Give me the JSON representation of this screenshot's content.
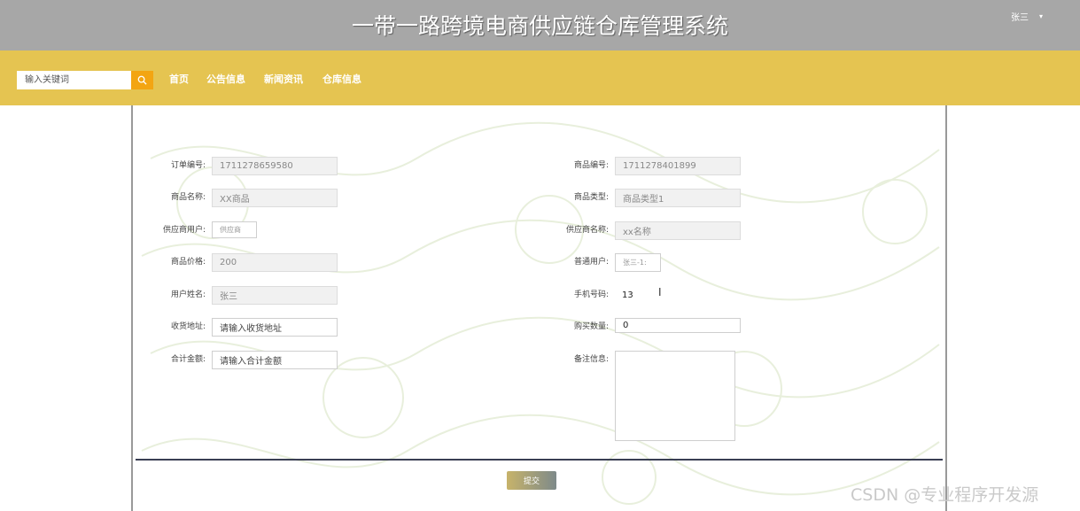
{
  "header": {
    "title": "一带一路跨境电商供应链仓库管理系统",
    "user_name": "张三",
    "user_caret": "▾"
  },
  "nav": {
    "search_placeholder": "输入关键词",
    "items": [
      "首页",
      "公告信息",
      "新闻资讯",
      "仓库信息"
    ]
  },
  "form": {
    "left": [
      {
        "label": "订单编号:",
        "value": "1711278659580"
      },
      {
        "label": "商品名称:",
        "value": "XX商品"
      },
      {
        "label": "供应商用户:",
        "value": "供应商"
      },
      {
        "label": "商品价格:",
        "value": "200"
      },
      {
        "label": "用户姓名:",
        "value": "张三"
      },
      {
        "label": "收货地址:",
        "placeholder": "请输入收货地址"
      },
      {
        "label": "合计金额:",
        "placeholder": "请输入合计金额"
      }
    ],
    "right": [
      {
        "label": "商品编号:",
        "value": "1711278401899"
      },
      {
        "label": "商品类型:",
        "value": "商品类型1"
      },
      {
        "label": "供应商名称:",
        "value": "xx名称"
      },
      {
        "label": "普通用户:",
        "value": "张三-1:"
      },
      {
        "label": "手机号码:",
        "value": "13"
      },
      {
        "label": "购买数量:",
        "value": "0"
      },
      {
        "label": "备注信息:",
        "value": ""
      }
    ],
    "submit_label": "提交"
  },
  "watermark": "CSDN @专业程序开发源"
}
